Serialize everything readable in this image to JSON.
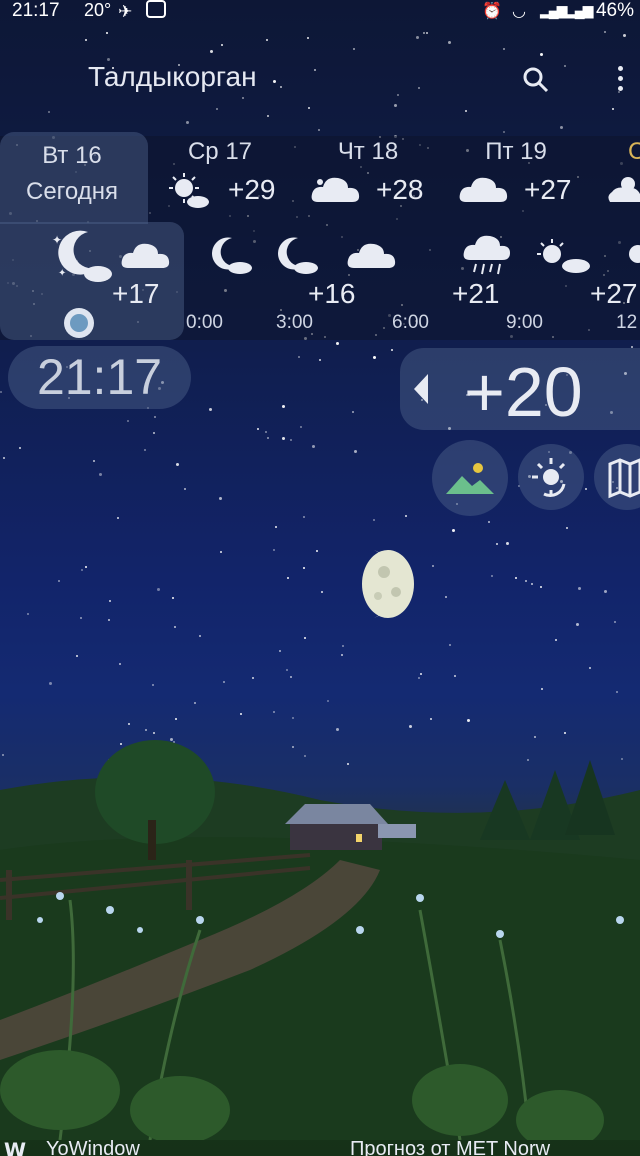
{
  "status_bar": {
    "time": "21:17",
    "temp": "20°",
    "battery": "46%"
  },
  "app": {
    "city": "Талдыкорган"
  },
  "days": [
    {
      "name": "Вт 16",
      "subtitle": "Сегодня",
      "icon": "moon-cloud-icon"
    },
    {
      "name": "Ср 17",
      "temp": "+29",
      "icon": "sun-cloud-icon"
    },
    {
      "name": "Чт 18",
      "temp": "+28",
      "icon": "cloud-icon"
    },
    {
      "name": "Пт 19",
      "temp": "+27",
      "icon": "cloud-icon"
    },
    {
      "name": "С",
      "icon": "sun-cloud-icon"
    }
  ],
  "hours": [
    {
      "time": "0:00",
      "temp": "+17",
      "icon": "moon-cloud-icon"
    },
    {
      "time": "3:00",
      "temp": "+16",
      "icon": "moon-cloud-icon"
    },
    {
      "time": "6:00",
      "icon": "cloud-icon"
    },
    {
      "time": "9:00",
      "temp": "+21",
      "icon": "rain-cloud-icon"
    },
    {
      "time": "12",
      "temp": "+27",
      "icon": "sun-cloud-icon"
    }
  ],
  "current": {
    "clock": "21:17",
    "temp": "+20"
  },
  "footer": {
    "left": "YoWindow",
    "right": "Прогноз от MET Norw"
  },
  "colors": {
    "panel": "#50648c",
    "sky_top": "#0d1736",
    "sky_mid": "#12246a",
    "grass": "#163118",
    "text": "#e8ebf3"
  }
}
